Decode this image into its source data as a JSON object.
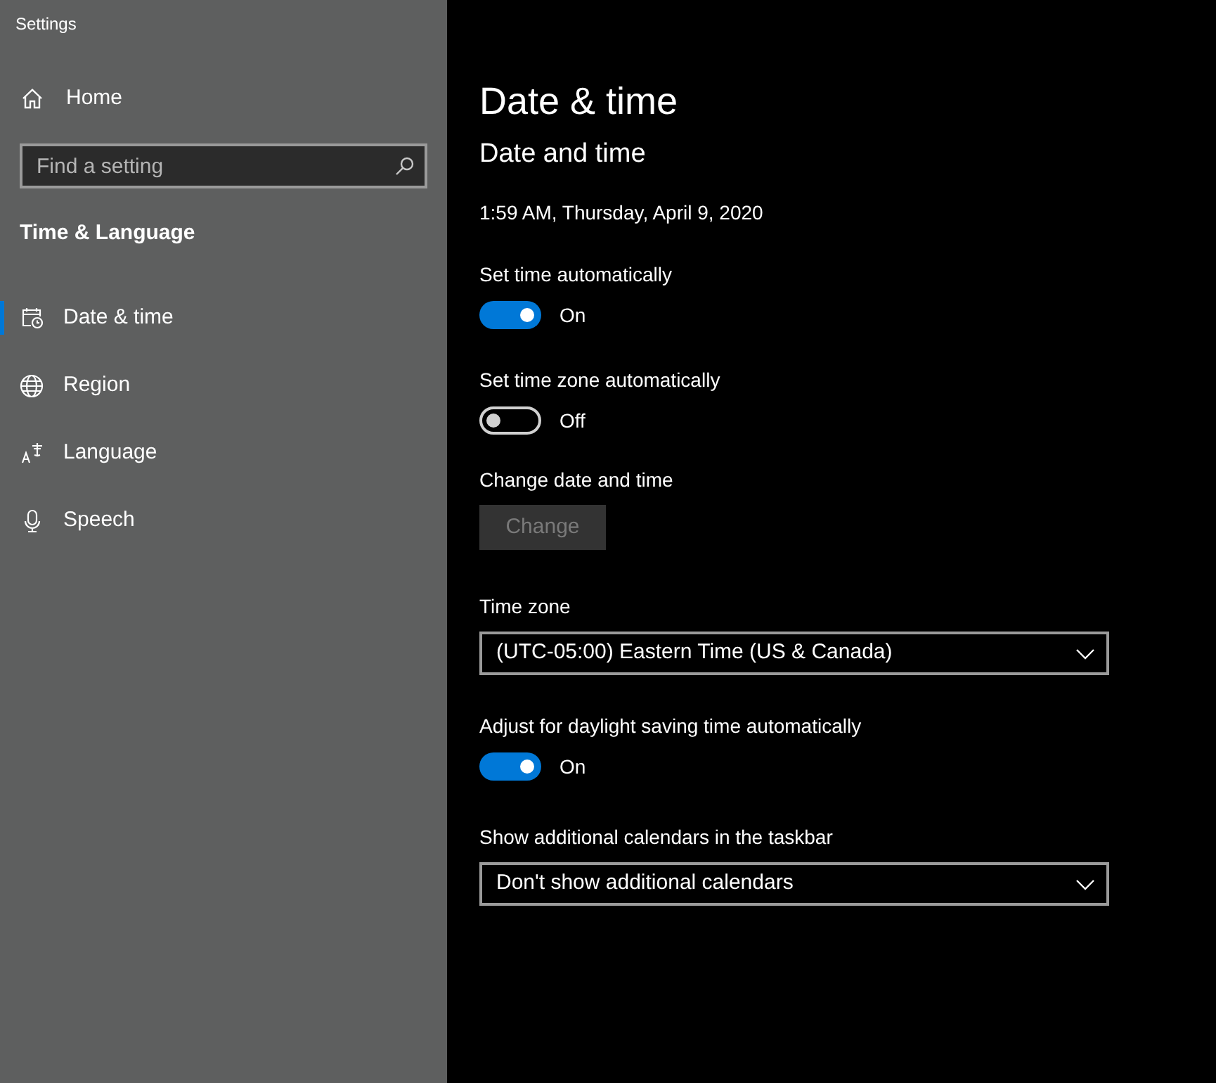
{
  "window": {
    "title": "Settings"
  },
  "sidebar": {
    "home": "Home",
    "search": {
      "placeholder": "Find a setting"
    },
    "section": "Time & Language",
    "items": [
      {
        "label": "Date & time",
        "selected": true
      },
      {
        "label": "Region",
        "selected": false
      },
      {
        "label": "Language",
        "selected": false
      },
      {
        "label": "Speech",
        "selected": false
      }
    ]
  },
  "page": {
    "title": "Date & time",
    "subtitle": "Date and time",
    "settings": [
      {
        "kind": "text",
        "text": "1:59 AM, Thursday, April 9, 2020"
      },
      {
        "kind": "toggle",
        "label": "Set time automatically",
        "on": true,
        "state_text": "On"
      },
      {
        "kind": "toggle",
        "label": "Set time zone automatically",
        "on": false,
        "state_text": "Off"
      },
      {
        "kind": "button",
        "label": "Change date and time",
        "button": "Change",
        "disabled": true
      },
      {
        "kind": "dropdown",
        "label": "Time zone",
        "value": "(UTC-05:00) Eastern Time (US & Canada)"
      },
      {
        "kind": "toggle",
        "label": "Adjust for daylight saving time automatically",
        "on": true,
        "state_text": "On"
      },
      {
        "kind": "dropdown",
        "label": "Show additional calendars in the taskbar",
        "value": "Don't show additional calendars"
      }
    ]
  }
}
